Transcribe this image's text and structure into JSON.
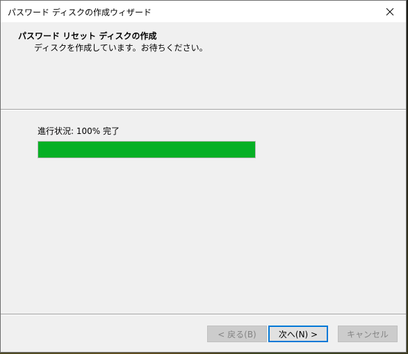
{
  "window": {
    "title": "パスワード ディスクの作成ウィザード"
  },
  "header": {
    "title": "パスワード リセット ディスクの作成",
    "subtitle": "ディスクを作成しています。お待ちください。"
  },
  "progress": {
    "label": "進行状況: 100% 完了",
    "percent": 100,
    "fill_color": "#06b025"
  },
  "buttons": {
    "back_label": "< 戻る(B)",
    "next_label": "次へ(N) >",
    "cancel_label": "キャンセル"
  },
  "icons": {
    "close": "close-icon"
  }
}
